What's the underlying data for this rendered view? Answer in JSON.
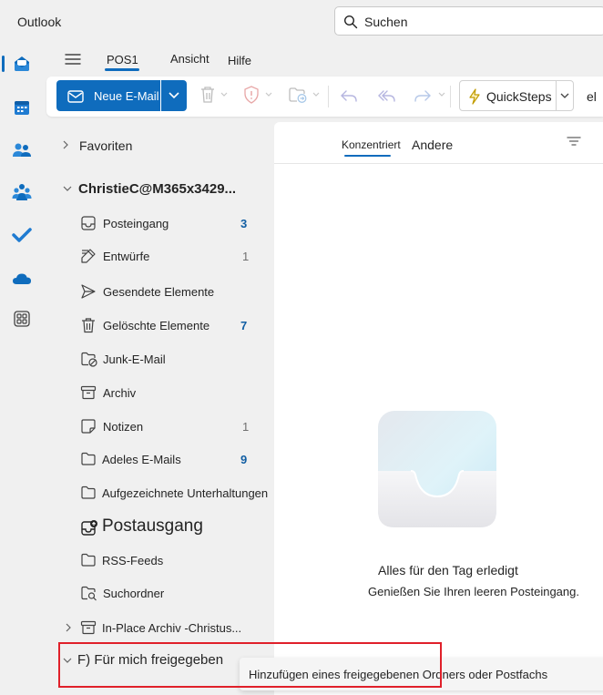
{
  "app": {
    "title": "Outlook"
  },
  "search": {
    "placeholder": "Suchen"
  },
  "ribbon_tabs": [
    {
      "label": "POS1",
      "active": true
    },
    {
      "label": "Ansicht"
    },
    {
      "label": "Hilfe"
    }
  ],
  "ribbon": {
    "new_mail_label": "Neue E-Mail",
    "quicksteps_label": "QuickSteps",
    "overflow_label": "el"
  },
  "folders": {
    "favorites": "Favoriten",
    "account": "ChristieC@M365x3429...",
    "items": [
      {
        "label": "Posteingang",
        "count": "3",
        "count_style": "bold",
        "icon": "inbox-icon"
      },
      {
        "label": "Entwürfe",
        "count": "1",
        "count_style": "light",
        "icon": "drafts-icon"
      },
      {
        "label": "Gesendete Elemente",
        "icon": "sent-icon"
      },
      {
        "label": "Gelöschte Elemente",
        "count": "7",
        "count_style": "bold",
        "icon": "trash-icon"
      },
      {
        "label": "Junk-E-Mail",
        "icon": "junk-folder-icon"
      },
      {
        "label": "Archiv",
        "icon": "archive-icon"
      },
      {
        "label": "Notizen",
        "count": "1",
        "count_style": "light",
        "icon": "notes-icon"
      },
      {
        "label": "Adeles E-Mails",
        "count": "9",
        "count_style": "bold",
        "icon": "folder-icon"
      },
      {
        "label": "Aufgezeichnete Unterhaltungen",
        "icon": "folder-icon"
      },
      {
        "label": "Postausgang",
        "icon": "outbox-icon"
      },
      {
        "label": "RSS-Feeds",
        "icon": "folder-icon"
      },
      {
        "label": "Suchordner",
        "icon": "search-folder-icon"
      }
    ],
    "inplace_archive": "In-Place Archiv -Christus...",
    "shared": "F) Für mich freigegeben"
  },
  "message_list": {
    "tab_focused": "Konzentriert",
    "tab_other": "Andere",
    "empty_title": "Alles für den Tag erledigt",
    "empty_subtitle": "Genießen Sie Ihren leeren Posteingang."
  },
  "tooltip": {
    "text": "Hinzufügen eines freigegebenen Ordners oder Postfachs"
  },
  "colors": {
    "accent": "#0f6cbd",
    "count": "#115ea3",
    "highlight": "#e0202a"
  }
}
